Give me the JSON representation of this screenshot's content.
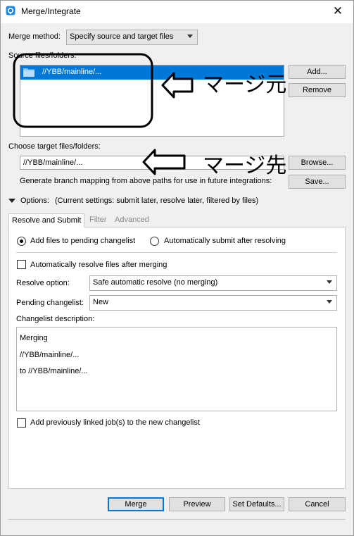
{
  "window": {
    "title": "Merge/Integrate"
  },
  "merge_method": {
    "label": "Merge method:",
    "value": "Specify source and target files"
  },
  "source": {
    "label": "Source files/folders:",
    "items": [
      "//YBB/mainline/..."
    ],
    "add_label": "Add...",
    "remove_label": "Remove"
  },
  "target": {
    "label": "Choose target files/folders:",
    "value": "//YBB/mainline/...",
    "browse_label": "Browse..."
  },
  "branch_mapping": {
    "label": "Generate branch mapping from above paths for use in future integrations:",
    "save_label": "Save..."
  },
  "options": {
    "label": "Options:",
    "summary": "(Current settings: submit later, resolve later, filtered by files)"
  },
  "tabs": [
    {
      "label": "Resolve and Submit"
    },
    {
      "label": "Filter"
    },
    {
      "label": "Advanced"
    }
  ],
  "resolve_submit": {
    "add_to_pending": "Add files to pending changelist",
    "auto_submit": "Automatically submit after resolving",
    "auto_resolve": "Automatically resolve files after merging",
    "resolve_option_label": "Resolve option:",
    "resolve_option_value": "Safe automatic resolve (no merging)",
    "pending_label": "Pending changelist:",
    "pending_value": "New",
    "desc_label": "Changelist description:",
    "desc_lines": [
      "Merging",
      "//YBB/mainline/...",
      "to //YBB/mainline/..."
    ],
    "add_linked_jobs": "Add previously linked job(s) to the new changelist"
  },
  "buttons": {
    "merge": "Merge",
    "preview": "Preview",
    "set_defaults": "Set Defaults...",
    "cancel": "Cancel"
  },
  "annotations": {
    "source_note": "マージ元",
    "target_note": "マージ先"
  },
  "colors": {
    "selection": "#0078d7",
    "app_icon": "#1e88e5"
  }
}
